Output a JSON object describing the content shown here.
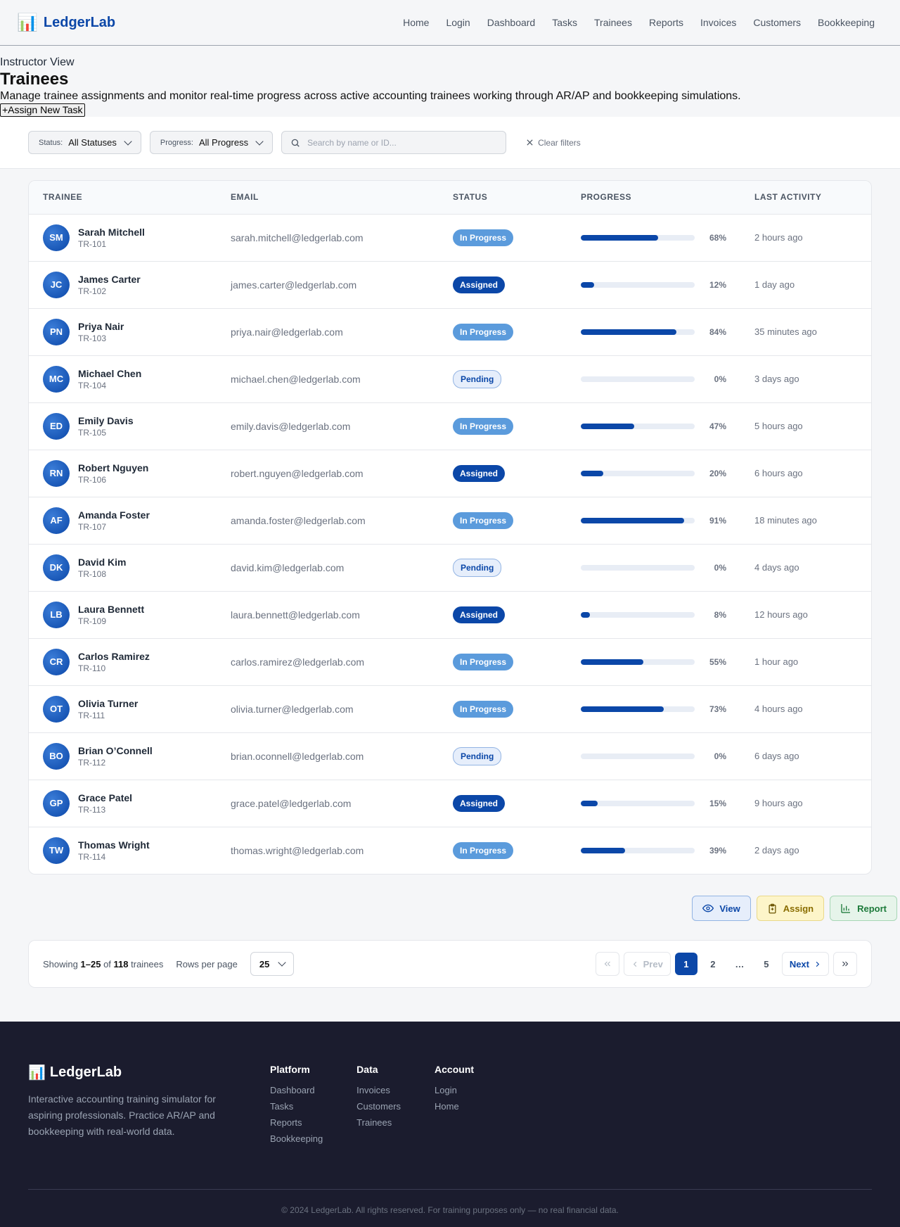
{
  "header": {
    "brand": "LedgerLab",
    "nav": [
      "Home",
      "Login",
      "Dashboard",
      "Tasks",
      "Trainees",
      "Reports",
      "Invoices",
      "Customers",
      "Bookkeeping"
    ]
  },
  "page": {
    "eyebrow": "Instructor View",
    "title": "Trainees",
    "description": "Manage trainee assignments and monitor real-time progress across active accounting trainees working through AR/AP and bookkeeping simulations.",
    "assign_button": "+Assign New Task"
  },
  "filters": {
    "status_label": "Status:",
    "status_value": "All Statuses",
    "progress_label": "Progress:",
    "progress_value": "All Progress",
    "search_placeholder": "Search by name or ID...",
    "clear_label": "Clear filters"
  },
  "table": {
    "headers": [
      "TRAINEE",
      "EMAIL",
      "STATUS",
      "PROGRESS",
      "LAST ACTIVITY"
    ],
    "rows": [
      {
        "initials": "SM",
        "name": "Sarah Mitchell",
        "id": "TR-101",
        "email": "sarah.mitchell@ledgerlab.com",
        "status": "In Progress",
        "status_kind": "progress",
        "progress": 68,
        "progress_label": "68%",
        "activity": "2 hours ago"
      },
      {
        "initials": "JC",
        "name": "James Carter",
        "id": "TR-102",
        "email": "james.carter@ledgerlab.com",
        "status": "Assigned",
        "status_kind": "assigned",
        "progress": 12,
        "progress_label": "12%",
        "activity": "1 day ago"
      },
      {
        "initials": "PN",
        "name": "Priya Nair",
        "id": "TR-103",
        "email": "priya.nair@ledgerlab.com",
        "status": "In Progress",
        "status_kind": "progress",
        "progress": 84,
        "progress_label": "84%",
        "activity": "35 minutes ago"
      },
      {
        "initials": "MC",
        "name": "Michael Chen",
        "id": "TR-104",
        "email": "michael.chen@ledgerlab.com",
        "status": "Pending",
        "status_kind": "pending",
        "progress": 0,
        "progress_label": "0%",
        "activity": "3 days ago"
      },
      {
        "initials": "ED",
        "name": "Emily Davis",
        "id": "TR-105",
        "email": "emily.davis@ledgerlab.com",
        "status": "In Progress",
        "status_kind": "progress",
        "progress": 47,
        "progress_label": "47%",
        "activity": "5 hours ago"
      },
      {
        "initials": "RN",
        "name": "Robert Nguyen",
        "id": "TR-106",
        "email": "robert.nguyen@ledgerlab.com",
        "status": "Assigned",
        "status_kind": "assigned",
        "progress": 20,
        "progress_label": "20%",
        "activity": "6 hours ago"
      },
      {
        "initials": "AF",
        "name": "Amanda Foster",
        "id": "TR-107",
        "email": "amanda.foster@ledgerlab.com",
        "status": "In Progress",
        "status_kind": "progress",
        "progress": 91,
        "progress_label": "91%",
        "activity": "18 minutes ago"
      },
      {
        "initials": "DK",
        "name": "David Kim",
        "id": "TR-108",
        "email": "david.kim@ledgerlab.com",
        "status": "Pending",
        "status_kind": "pending",
        "progress": 0,
        "progress_label": "0%",
        "activity": "4 days ago"
      },
      {
        "initials": "LB",
        "name": "Laura Bennett",
        "id": "TR-109",
        "email": "laura.bennett@ledgerlab.com",
        "status": "Assigned",
        "status_kind": "assigned",
        "progress": 8,
        "progress_label": "8%",
        "activity": "12 hours ago"
      },
      {
        "initials": "CR",
        "name": "Carlos Ramirez",
        "id": "TR-110",
        "email": "carlos.ramirez@ledgerlab.com",
        "status": "In Progress",
        "status_kind": "progress",
        "progress": 55,
        "progress_label": "55%",
        "activity": "1 hour ago"
      },
      {
        "initials": "OT",
        "name": "Olivia Turner",
        "id": "TR-111",
        "email": "olivia.turner@ledgerlab.com",
        "status": "In Progress",
        "status_kind": "progress",
        "progress": 73,
        "progress_label": "73%",
        "activity": "4 hours ago"
      },
      {
        "initials": "BO",
        "name": "Brian O’Connell",
        "id": "TR-112",
        "email": "brian.oconnell@ledgerlab.com",
        "status": "Pending",
        "status_kind": "pending",
        "progress": 0,
        "progress_label": "0%",
        "activity": "6 days ago"
      },
      {
        "initials": "GP",
        "name": "Grace Patel",
        "id": "TR-113",
        "email": "grace.patel@ledgerlab.com",
        "status": "Assigned",
        "status_kind": "assigned",
        "progress": 15,
        "progress_label": "15%",
        "activity": "9 hours ago"
      },
      {
        "initials": "TW",
        "name": "Thomas Wright",
        "id": "TR-114",
        "email": "thomas.wright@ledgerlab.com",
        "status": "In Progress",
        "status_kind": "progress",
        "progress": 39,
        "progress_label": "39%",
        "activity": "2 days ago"
      }
    ]
  },
  "actions": {
    "view": "View",
    "assign": "Assign",
    "report": "Report"
  },
  "pagination": {
    "showing_prefix": "Showing",
    "range_start": "1",
    "range_sep": "–",
    "range_end": "25",
    "of": "of",
    "total": "118",
    "unit": "trainees",
    "rows_label": "Rows per page",
    "rows_value": "25",
    "prev": "Prev",
    "next": "Next",
    "pages": [
      "1",
      "2",
      "…",
      "5"
    ],
    "current_page": "1"
  },
  "footer": {
    "brand": "LedgerLab",
    "description": "Interactive accounting training simulator for aspiring professionals. Practice AR/AP and bookkeeping with real-world data.",
    "columns": [
      {
        "title": "Platform",
        "links": [
          "Dashboard",
          "Tasks",
          "Reports",
          "Bookkeeping"
        ]
      },
      {
        "title": "Data",
        "links": [
          "Invoices",
          "Customers",
          "Trainees"
        ]
      },
      {
        "title": "Account",
        "links": [
          "Login",
          "Home"
        ]
      }
    ],
    "copyright": "© 2024 LedgerLab. All rights reserved. For training purposes only — no real financial data."
  },
  "colors": {
    "brand": "#0b47a8",
    "in_progress": "#5b9bdc",
    "assigned": "#0b47a8",
    "pending_bg": "#e6eefb",
    "footer_bg": "#1b1c2e"
  },
  "icons": {
    "brand": "bar-chart-icon",
    "search": "search-icon",
    "clear": "close-icon",
    "view": "eye-icon",
    "assign": "clipboard-icon",
    "report": "chart-icon"
  }
}
